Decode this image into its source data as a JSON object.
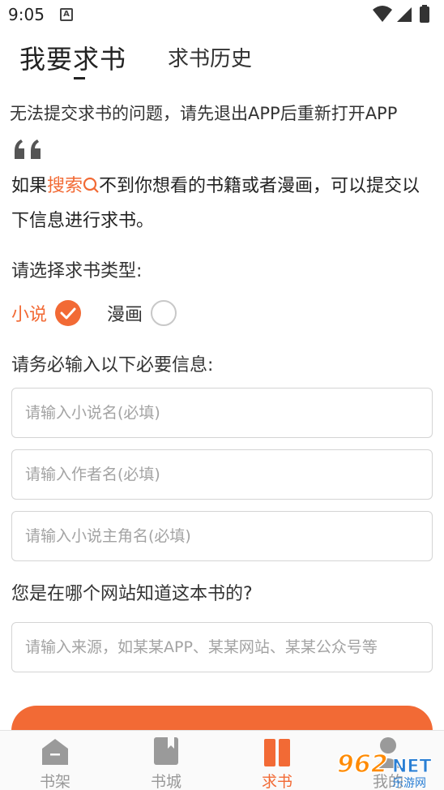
{
  "status_bar": {
    "time": "9:05",
    "notification_glyph": "A"
  },
  "tabs": {
    "active": "我要求书",
    "inactive": "求书历史"
  },
  "notice": "无法提交求书的问题，请先退出APP后重新打开APP",
  "intro": {
    "prefix": "如果",
    "highlight": "搜索",
    "rest": "不到你想看的书籍或者漫画，可以提交以下信息进行求书。"
  },
  "type_label": "请选择求书类型:",
  "types": [
    {
      "label": "小说",
      "selected": true
    },
    {
      "label": "漫画",
      "selected": false
    }
  ],
  "required_label": "请务必输入以下必要信息:",
  "fields": {
    "book_name": "请输入小说名(必填)",
    "author": "请输入作者名(必填)",
    "protagonist": "请输入小说主角名(必填)",
    "source": "请输入来源，如某某APP、某某网站、某某公众号等"
  },
  "source_label": "您是在哪个网站知道这本书的?",
  "nav": [
    {
      "label": "书架",
      "icon": "bookshelf-icon"
    },
    {
      "label": "书城",
      "icon": "book-icon"
    },
    {
      "label": "求书",
      "icon": "request-book-icon",
      "active": true
    },
    {
      "label": "我的",
      "icon": "profile-icon"
    }
  ],
  "watermark": {
    "brand": "962",
    "suffix": "NET",
    "subtitle": "乐游网"
  },
  "colors": {
    "accent": "#f26a35",
    "inactive_nav": "#9a9a9a"
  }
}
